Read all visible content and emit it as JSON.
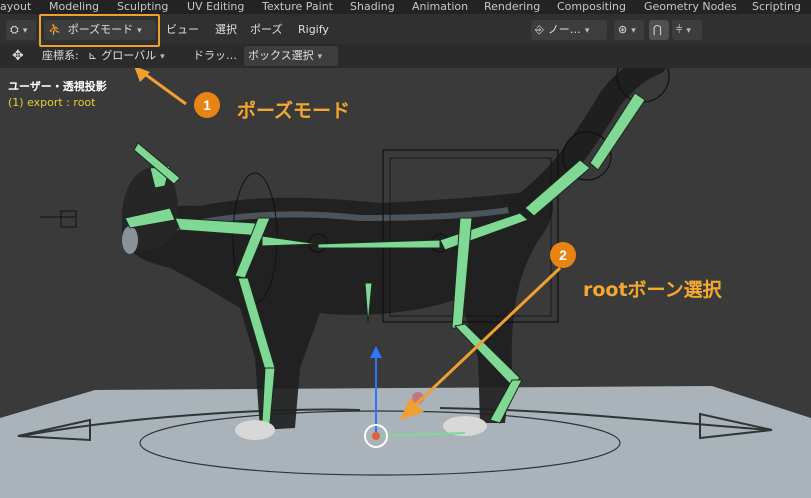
{
  "workspace_tabs": [
    "ayout",
    "Modeling",
    "Sculpting",
    "UV Editing",
    "Texture Paint",
    "Shading",
    "Animation",
    "Rendering",
    "Compositing",
    "Geometry Nodes",
    "Scripting"
  ],
  "header": {
    "mode_label": "ポーズモード",
    "menus": [
      "ビュー",
      "選択",
      "ポーズ",
      "Rigify"
    ],
    "right_dropdown": "ノー…"
  },
  "toolbar": {
    "coord_label": "座標系:",
    "coord_value": "グローバル",
    "drag_label": "ドラッ…",
    "select_value": "ボックス選択"
  },
  "viewport": {
    "view_name": "ユーザー・透視投影",
    "object_info": "(1) export : root"
  },
  "annotations": {
    "step1_number": "1",
    "step1_text": "ポーズモード",
    "step2_number": "2",
    "step2_text": "rootボーン選択",
    "color": "#f0a030"
  },
  "colors": {
    "bone": "#7fd894",
    "info_yellow": "#e8d030",
    "header_bg": "#303030",
    "viewport_bg": "#3a3a3a"
  }
}
